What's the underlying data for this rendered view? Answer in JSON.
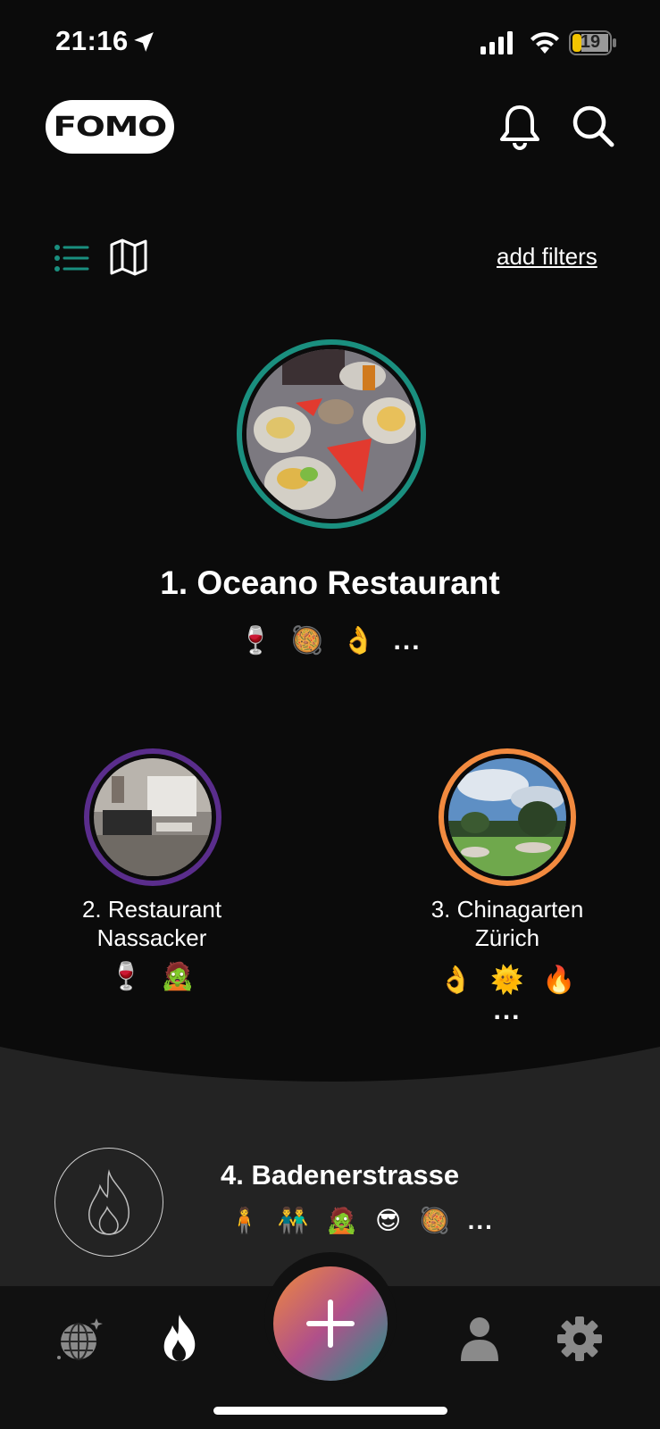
{
  "status_bar": {
    "time": "21:16",
    "battery": "19"
  },
  "header": {
    "logo": "FOMO"
  },
  "view_toggle": {
    "filters_label": "add filters"
  },
  "ranking": [
    {
      "label": "1. Oceano Restaurant",
      "emojis": [
        "🍷",
        "🥘",
        "👌"
      ],
      "more": "...",
      "ring_color": "#1a8f7f"
    },
    {
      "label_line1": "2. Restaurant",
      "label_line2": "Nassacker",
      "emojis": [
        "🍷",
        "🧟"
      ],
      "ring_color": "#5a2d8c"
    },
    {
      "label_line1": "3. Chinagarten",
      "label_line2": "Zürich",
      "emojis": [
        "👌",
        "🌞",
        "🔥"
      ],
      "more": "...",
      "ring_color": "#f28a3f"
    },
    {
      "label": "4. Badenerstrasse",
      "emojis": [
        "🧍",
        "👬",
        "🧟",
        "😎",
        "🥘"
      ],
      "more": "..."
    }
  ],
  "colors": {
    "accent_teal": "#1a8f7f",
    "background": "#0b0b0b",
    "lower_panel": "#232323"
  },
  "icons": [
    "location-arrow-icon",
    "signal-icon",
    "wifi-icon",
    "battery-icon",
    "bell-icon",
    "search-icon",
    "list-icon",
    "map-icon",
    "fire-icon",
    "globe-icon",
    "flame-icon",
    "plus-icon",
    "person-icon",
    "gear-icon"
  ]
}
